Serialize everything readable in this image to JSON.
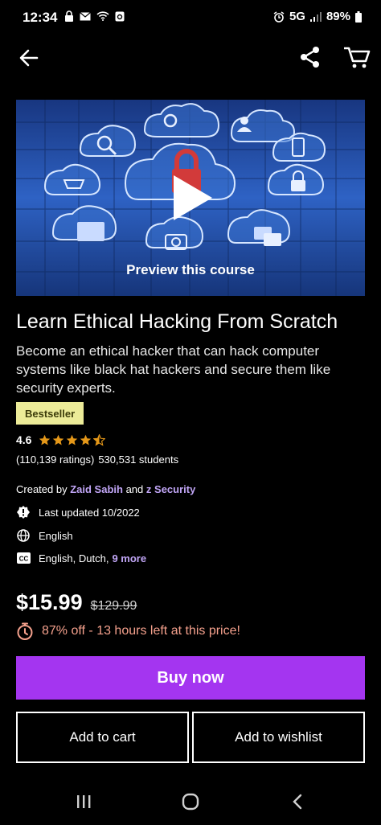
{
  "status": {
    "time": "12:34",
    "network": "5G",
    "battery": "89%"
  },
  "preview": {
    "label": "Preview this course"
  },
  "course": {
    "title": "Learn Ethical Hacking From Scratch",
    "subtitle": "Become an ethical hacker that can hack computer systems like black hat hackers and secure them like security experts.",
    "badge": "Bestseller",
    "rating": "4.6",
    "ratings_count": "(110,139 ratings)",
    "students": "530,531 students",
    "created_prefix": "Created by",
    "author1": "Zaid Sabih",
    "and_text": "and",
    "author2": "z Security",
    "last_updated": "Last updated 10/2022",
    "language": "English",
    "captions": "English, Dutch,",
    "captions_more": "9 more"
  },
  "pricing": {
    "price": "$15.99",
    "original_price": "$129.99",
    "discount": "87% off - 13 hours left at this price!"
  },
  "actions": {
    "buy_now": "Buy now",
    "add_to_cart": "Add to cart",
    "add_to_wishlist": "Add to wishlist"
  },
  "icons": {
    "back": "arrow-left-icon",
    "share": "share-icon",
    "cart": "cart-icon",
    "play": "play-icon",
    "update": "alert-badge-icon",
    "language": "globe-icon",
    "captions": "closed-captions-icon",
    "timer": "stopwatch-icon"
  },
  "colors": {
    "accent": "#a435f0",
    "badge_bg": "#eceb98",
    "star": "#e59819",
    "link": "#c0a5f5",
    "discount": "#f4a08c"
  }
}
